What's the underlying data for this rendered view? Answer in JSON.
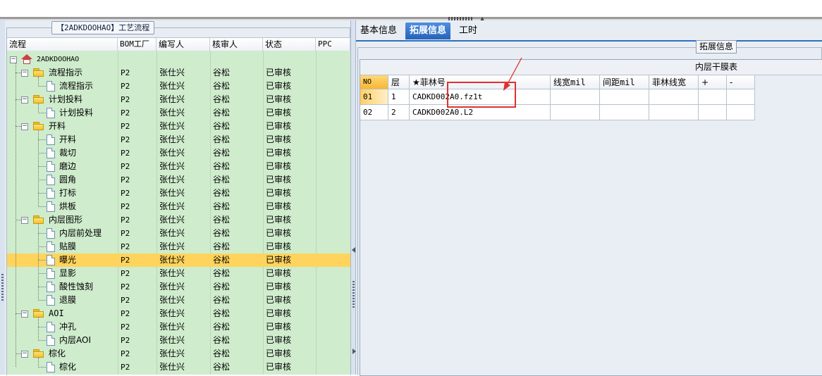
{
  "left_panel": {
    "title": "【2ADKDOOHAO】工艺流程",
    "columns": [
      "流程",
      "BOM工厂",
      "编写人",
      "核审人",
      "状态",
      "PPC"
    ],
    "rows": [
      {
        "depth": 0,
        "kind": "root",
        "name": "2ADKDOOHAO",
        "bom": "",
        "writer": "",
        "reviewer": "",
        "status": "",
        "ppc": ""
      },
      {
        "depth": 1,
        "kind": "folder",
        "name": "流程指示",
        "bom": "P2",
        "writer": "张仕兴",
        "reviewer": "谷松",
        "status": "已审核",
        "ppc": ""
      },
      {
        "depth": 2,
        "kind": "doc",
        "name": "流程指示",
        "bom": "P2",
        "writer": "张仕兴",
        "reviewer": "谷松",
        "status": "已审核",
        "ppc": ""
      },
      {
        "depth": 1,
        "kind": "folder",
        "name": "计划投料",
        "bom": "P2",
        "writer": "张仕兴",
        "reviewer": "谷松",
        "status": "已审核",
        "ppc": ""
      },
      {
        "depth": 2,
        "kind": "doc",
        "name": "计划投料",
        "bom": "P2",
        "writer": "张仕兴",
        "reviewer": "谷松",
        "status": "已审核",
        "ppc": ""
      },
      {
        "depth": 1,
        "kind": "folder",
        "name": "开料",
        "bom": "P2",
        "writer": "张仕兴",
        "reviewer": "谷松",
        "status": "已审核",
        "ppc": ""
      },
      {
        "depth": 2,
        "kind": "doc",
        "name": "开料",
        "bom": "P2",
        "writer": "张仕兴",
        "reviewer": "谷松",
        "status": "已审核",
        "ppc": ""
      },
      {
        "depth": 2,
        "kind": "doc",
        "name": "裁切",
        "bom": "P2",
        "writer": "张仕兴",
        "reviewer": "谷松",
        "status": "已审核",
        "ppc": ""
      },
      {
        "depth": 2,
        "kind": "doc",
        "name": "磨边",
        "bom": "P2",
        "writer": "张仕兴",
        "reviewer": "谷松",
        "status": "已审核",
        "ppc": ""
      },
      {
        "depth": 2,
        "kind": "doc",
        "name": "圆角",
        "bom": "P2",
        "writer": "张仕兴",
        "reviewer": "谷松",
        "status": "已审核",
        "ppc": ""
      },
      {
        "depth": 2,
        "kind": "doc",
        "name": "打标",
        "bom": "P2",
        "writer": "张仕兴",
        "reviewer": "谷松",
        "status": "已审核",
        "ppc": ""
      },
      {
        "depth": 2,
        "kind": "doc",
        "name": "烘板",
        "bom": "P2",
        "writer": "张仕兴",
        "reviewer": "谷松",
        "status": "已审核",
        "ppc": ""
      },
      {
        "depth": 1,
        "kind": "folder",
        "name": "内层图形",
        "bom": "P2",
        "writer": "张仕兴",
        "reviewer": "谷松",
        "status": "已审核",
        "ppc": ""
      },
      {
        "depth": 2,
        "kind": "doc",
        "name": "内层前处理",
        "bom": "P2",
        "writer": "张仕兴",
        "reviewer": "谷松",
        "status": "已审核",
        "ppc": ""
      },
      {
        "depth": 2,
        "kind": "doc",
        "name": "贴膜",
        "bom": "P2",
        "writer": "张仕兴",
        "reviewer": "谷松",
        "status": "已审核",
        "ppc": ""
      },
      {
        "depth": 2,
        "kind": "doc",
        "name": "曝光",
        "bom": "P2",
        "writer": "张仕兴",
        "reviewer": "谷松",
        "status": "已审核",
        "ppc": "",
        "selected": true
      },
      {
        "depth": 2,
        "kind": "doc",
        "name": "显影",
        "bom": "P2",
        "writer": "张仕兴",
        "reviewer": "谷松",
        "status": "已审核",
        "ppc": ""
      },
      {
        "depth": 2,
        "kind": "doc",
        "name": "酸性蚀刻",
        "bom": "P2",
        "writer": "张仕兴",
        "reviewer": "谷松",
        "status": "已审核",
        "ppc": ""
      },
      {
        "depth": 2,
        "kind": "doc",
        "name": "退膜",
        "bom": "P2",
        "writer": "张仕兴",
        "reviewer": "谷松",
        "status": "已审核",
        "ppc": ""
      },
      {
        "depth": 1,
        "kind": "folder",
        "name": "AOI",
        "bom": "P2",
        "writer": "张仕兴",
        "reviewer": "谷松",
        "status": "已审核",
        "ppc": ""
      },
      {
        "depth": 2,
        "kind": "doc",
        "name": "冲孔",
        "bom": "P2",
        "writer": "张仕兴",
        "reviewer": "谷松",
        "status": "已审核",
        "ppc": ""
      },
      {
        "depth": 2,
        "kind": "doc",
        "name": "内层AOI",
        "bom": "P2",
        "writer": "张仕兴",
        "reviewer": "谷松",
        "status": "已审核",
        "ppc": ""
      },
      {
        "depth": 1,
        "kind": "folder",
        "name": "棕化",
        "bom": "P2",
        "writer": "张仕兴",
        "reviewer": "谷松",
        "status": "已审核",
        "ppc": ""
      },
      {
        "depth": 2,
        "kind": "doc",
        "name": "棕化",
        "bom": "P2",
        "writer": "张仕兴",
        "reviewer": "谷松",
        "status": "已审核",
        "ppc": ""
      }
    ]
  },
  "right_panel": {
    "tabs": [
      "基本信息",
      "拓展信息",
      "工时"
    ],
    "active_tab": 1,
    "group_title": "拓展信息",
    "grid_caption": "内层干膜表",
    "columns": [
      "NO",
      "层",
      "★菲林号",
      "线宽mil",
      "间距mil",
      "菲林线宽",
      "+",
      "-"
    ],
    "rows": [
      [
        "01",
        "1",
        "CADKD002A0.fz1t",
        "",
        "",
        "",
        "",
        ""
      ],
      [
        "02",
        "2",
        "CADKD002A0.L2",
        "",
        "",
        "",
        "",
        ""
      ]
    ]
  },
  "colors": {
    "tree_bg": "#cfeccd",
    "selected_row": "#ffd45c",
    "tab_active": "#2563b8",
    "highlight_box": "#e03030"
  }
}
